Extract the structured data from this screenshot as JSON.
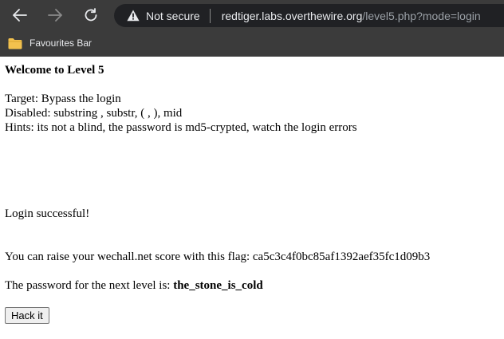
{
  "browser": {
    "security_label": "Not secure",
    "url_host": "redtiger.labs.overthewire.org",
    "url_path": "/level5.php?mode=login",
    "favourites_label": "Favourites Bar",
    "icons": {
      "back": "back-arrow-icon",
      "forward": "forward-arrow-icon",
      "reload": "reload-icon",
      "warning": "warning-triangle-icon",
      "folder": "folder-icon"
    },
    "colors": {
      "chrome_bg": "#3b3b3b",
      "address_bg": "#202124",
      "folder": "#f2c14e"
    }
  },
  "page": {
    "heading": "Welcome to Level 5",
    "target": "Target: Bypass the login",
    "disabled": "Disabled: substring , substr, ( , ), mid",
    "hints": "Hints: its not a blind, the password is md5-crypted, watch the login errors",
    "login_status": "Login successful!",
    "flag_text": "You can raise your wechall.net score with this flag: ca5c3c4f0bc85af1392aef35fc1d09b3",
    "password_prefix": "The password for the next level is: ",
    "password_value": "the_stone_is_cold",
    "hack_button_label": "Hack it"
  }
}
